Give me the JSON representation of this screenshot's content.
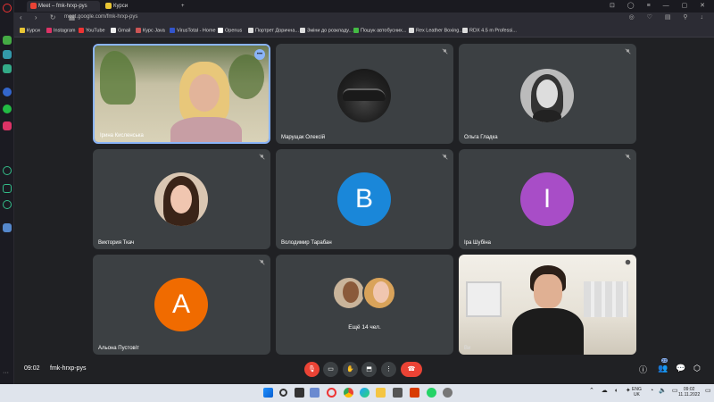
{
  "browser": {
    "tabs": [
      {
        "title": "Meet – fmk-hrxp-pys",
        "active": true
      },
      {
        "title": "Курси",
        "active": false
      }
    ],
    "url": "meet.google.com/fmk-hrxp-pys",
    "bookmarks": [
      "Курси",
      "Instagram",
      "YouTube",
      "Gmail",
      "Курс Java",
      "VirusTotal - Home",
      "Openus",
      "Портрет Дорична...",
      "Зміни до розкладу...",
      "Пошук автобусних...",
      "Rex Leather Boxing...",
      "RDX 4.5 m Professi..."
    ]
  },
  "participants": [
    {
      "name": "Ірина Кисленська",
      "type": "video"
    },
    {
      "name": "Марущак Олексій",
      "type": "photo"
    },
    {
      "name": "Ольга Гладка",
      "type": "photo"
    },
    {
      "name": "Виктория Ткач",
      "type": "photo"
    },
    {
      "name": "Володимир Тарабан",
      "type": "letter",
      "letter": "B",
      "color": "#1a87d9"
    },
    {
      "name": "Іра Шубіна",
      "type": "letter",
      "letter": "I",
      "color": "#a84dc7"
    },
    {
      "name": "Альона Пустовіт",
      "type": "letter",
      "letter": "A",
      "color": "#f06b00"
    },
    {
      "name": "Ви",
      "type": "video"
    }
  ],
  "more_tile": {
    "label": "Ещё 14 чел."
  },
  "controls": {
    "time": "09:02",
    "meeting_code": "fmk-hrxp-pys",
    "participants_count": "22"
  },
  "taskbar": {
    "lang": "ENG",
    "lang_sub": "UK",
    "clock_time": "09:02",
    "clock_date": "11.11.2022"
  },
  "colors": {
    "tile_bg": "#3c4043",
    "stage_bg": "#202124",
    "hangup": "#ea4335",
    "accent": "#8ab4f8"
  }
}
